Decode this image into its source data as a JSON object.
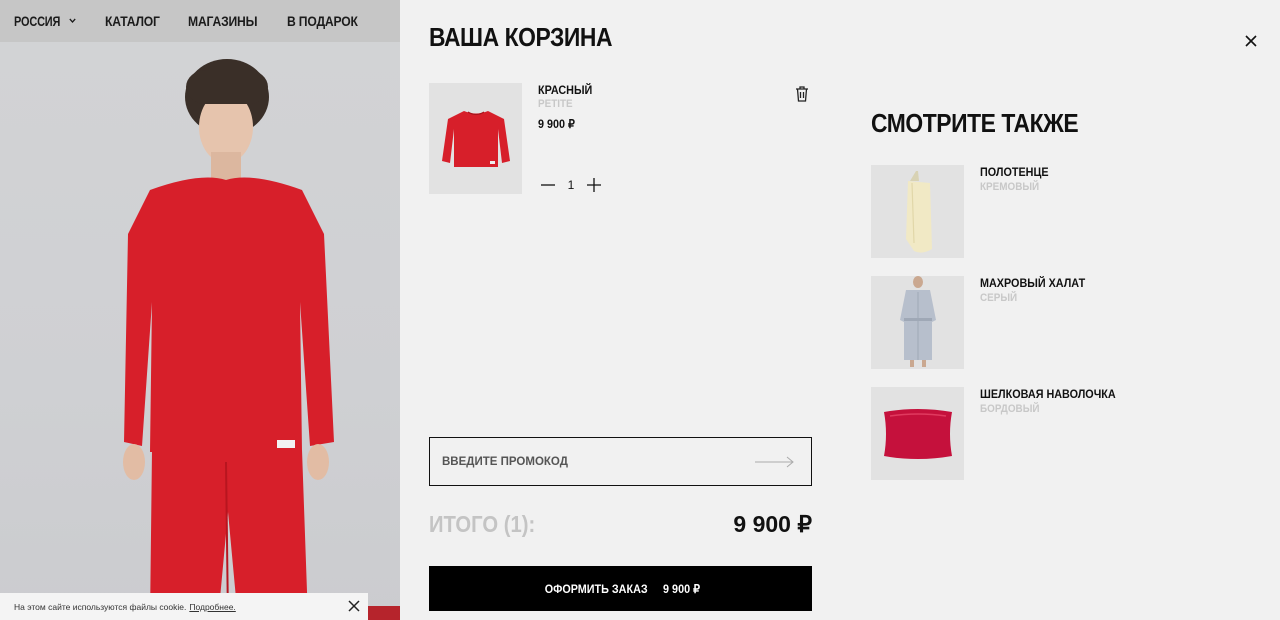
{
  "nav": {
    "region": "РОССИЯ",
    "items": [
      "КАТАЛОГ",
      "МАГАЗИНЫ",
      "В ПОДАРОК"
    ]
  },
  "cookie": {
    "text": "На этом сайте используются файлы cookie.",
    "link": "Подробнее."
  },
  "cart": {
    "title": "ВАША КОРЗИНА",
    "item": {
      "name": "КРАСНЫЙ",
      "size": "PETITE",
      "price": "9 900 ₽",
      "quantity": "1"
    },
    "promo_placeholder": "ВВЕДИТЕ ПРОМОКОД",
    "total_label": "ИТОГО (1):",
    "total_sum": "9 900 ₽",
    "checkout_label": "ОФОРМИТЬ ЗАКАЗ",
    "checkout_sum": "9 900 ₽"
  },
  "also": {
    "title": "СМОТРИТЕ ТАКЖЕ",
    "items": [
      {
        "name": "ПОЛОТЕНЦЕ",
        "color": "КРЕМОВЫЙ"
      },
      {
        "name": "МАХРОВЫЙ ХАЛАТ",
        "color": "СЕРЫЙ"
      },
      {
        "name": "ШЕЛКОВАЯ НАВОЛОЧКА",
        "color": "БОРДОВЫЙ"
      }
    ]
  },
  "colors": {
    "accent_red": "#d71f2a",
    "black": "#000000",
    "muted": "#c4c4c4",
    "background": "#f1f1f1"
  }
}
